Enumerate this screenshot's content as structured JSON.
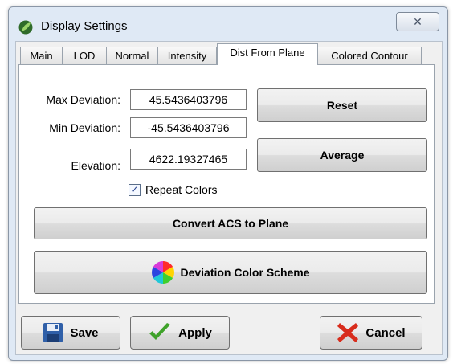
{
  "window": {
    "title": "Display Settings",
    "close_glyph": "✕"
  },
  "tabs": [
    {
      "label": "Main"
    },
    {
      "label": "LOD"
    },
    {
      "label": "Normal"
    },
    {
      "label": "Intensity"
    },
    {
      "label": "Dist From Plane"
    },
    {
      "label": "Colored Contour"
    }
  ],
  "active_tab": "Dist From Plane",
  "fields": {
    "max_deviation": {
      "label": "Max Deviation:",
      "value": "45.5436403796"
    },
    "min_deviation": {
      "label": "Min Deviation:",
      "value": "-45.5436403796"
    },
    "elevation": {
      "label": "Elevation:",
      "value": "4622.19327465"
    }
  },
  "buttons": {
    "reset": "Reset",
    "average": "Average",
    "convert": "Convert ACS to Plane",
    "color_scheme": "Deviation Color Scheme"
  },
  "repeat_colors": {
    "label": "Repeat Colors",
    "checked": true
  },
  "footer": {
    "save": "Save",
    "apply": "Apply",
    "cancel": "Cancel"
  },
  "colors": {
    "accent": "#dfe9f5",
    "apply_check": "#3fa22a",
    "cancel_x": "#d82c1c",
    "save_disk": "#2f5fa8"
  }
}
